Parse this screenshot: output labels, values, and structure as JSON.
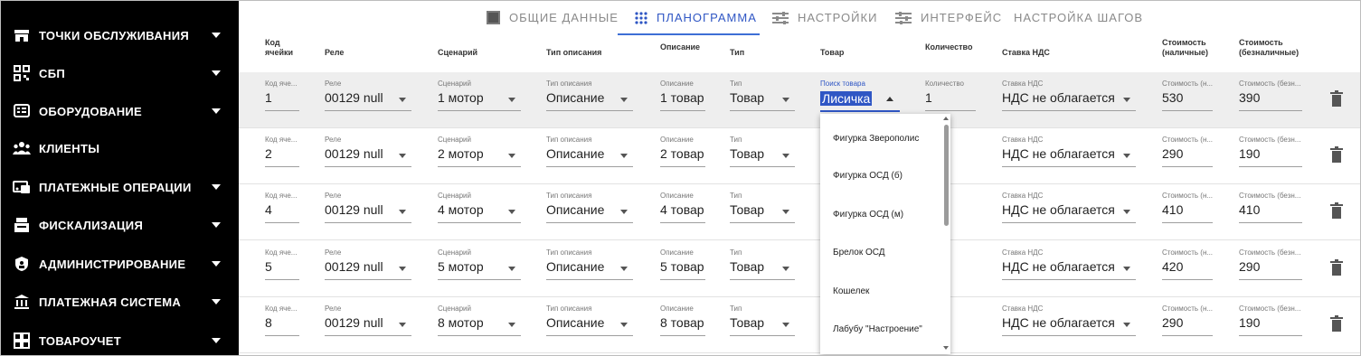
{
  "sidebar": {
    "items": [
      {
        "label": "ТОЧКИ ОБСЛУЖИВАНИЯ",
        "icon": "store-icon",
        "expandable": true
      },
      {
        "label": "СБП",
        "icon": "qr-code-icon",
        "expandable": true
      },
      {
        "label": "ОБОРУДОВАНИЕ",
        "icon": "equipment-icon",
        "expandable": true
      },
      {
        "label": "КЛИЕНТЫ",
        "icon": "users-icon",
        "expandable": false
      },
      {
        "label": "ПЛАТЕЖНЫЕ ОПЕРАЦИИ",
        "icon": "payment-icon",
        "expandable": true
      },
      {
        "label": "ФИСКАЛИЗАЦИЯ",
        "icon": "register-icon",
        "expandable": true
      },
      {
        "label": "АДМИНИСТРИРОВАНИЕ",
        "icon": "shield-icon",
        "expandable": true
      },
      {
        "label": "ПЛАТЕЖНАЯ СИСТЕМА",
        "icon": "bank-icon",
        "expandable": true
      },
      {
        "label": "ТОВАРОУЧЕТ",
        "icon": "grid-icon",
        "expandable": true
      }
    ]
  },
  "tabs": [
    {
      "label": "ОБЩИЕ ДАННЫЕ",
      "icon": "square-icon",
      "active": false
    },
    {
      "label": "ПЛАНОГРАММА",
      "icon": "dots-grid-icon",
      "active": true
    },
    {
      "label": "НАСТРОЙКИ",
      "icon": "sliders-icon",
      "active": false
    },
    {
      "label": "ИНТЕРФЕЙС",
      "icon": "sliders-icon",
      "active": false
    },
    {
      "label": "НАСТРОЙКА ШАГОВ",
      "icon": "",
      "active": false
    }
  ],
  "headers": {
    "cell_code": "Код\nячейки",
    "relay": "Реле",
    "scenario": "Сценарий",
    "desc_type": "Тип описания",
    "description": "Описание",
    "type": "Тип",
    "product": "Товар",
    "quantity": "Количество",
    "vat": "Ставка НДС",
    "cost_cash": "Стоимость\n(наличные)",
    "cost_cashless": "Стоимость\n(безналичные)"
  },
  "field_labels": {
    "cell_code": "Код яче...",
    "relay": "Реле",
    "scenario": "Сценарий",
    "desc_type": "Тип описания",
    "description": "Описание",
    "type": "Тип",
    "product_search": "Поиск товара",
    "quantity": "Количество",
    "vat": "Ставка НДС",
    "cost_cash": "Стоимость (н...",
    "cost_cashless": "Стоимость (безн..."
  },
  "rows": [
    {
      "cell": "1",
      "relay": "00129 null",
      "scenario": "1 мотор",
      "desc_type": "Описание",
      "description": "1 товар",
      "type": "Товар",
      "product": "Лисичка",
      "quantity": "1",
      "vat": "НДС не облагается",
      "cost_cash": "530",
      "cost_cashless": "390"
    },
    {
      "cell": "2",
      "relay": "00129 null",
      "scenario": "2 мотор",
      "desc_type": "Описание",
      "description": "2 товар",
      "type": "Товар",
      "vat": "НДС не облагается",
      "cost_cash": "290",
      "cost_cashless": "190"
    },
    {
      "cell": "4",
      "relay": "00129 null",
      "scenario": "4 мотор",
      "desc_type": "Описание",
      "description": "4 товар",
      "type": "Товар",
      "vat": "НДС не облагается",
      "cost_cash": "410",
      "cost_cashless": "410"
    },
    {
      "cell": "5",
      "relay": "00129 null",
      "scenario": "5 мотор",
      "desc_type": "Описание",
      "description": "5 товар",
      "type": "Товар",
      "vat": "НДС не облагается",
      "cost_cash": "420",
      "cost_cashless": "290"
    },
    {
      "cell": "8",
      "relay": "00129 null",
      "scenario": "8 мотор",
      "desc_type": "Описание",
      "description": "8 товар",
      "type": "Товар",
      "vat": "НДС не облагается",
      "cost_cash": "290",
      "cost_cashless": "190"
    }
  ],
  "dropdown": {
    "options": [
      "Фигурка Зверополис",
      "Фигурка ОСД (б)",
      "Фигурка ОСД (м)",
      "Брелок ОСД",
      "Кошелек",
      "Лабубу \"Настроение\""
    ]
  },
  "colors": {
    "accent": "#2f56c4",
    "sidebar_bg": "#000000",
    "row_highlight": "#eeeeee"
  }
}
